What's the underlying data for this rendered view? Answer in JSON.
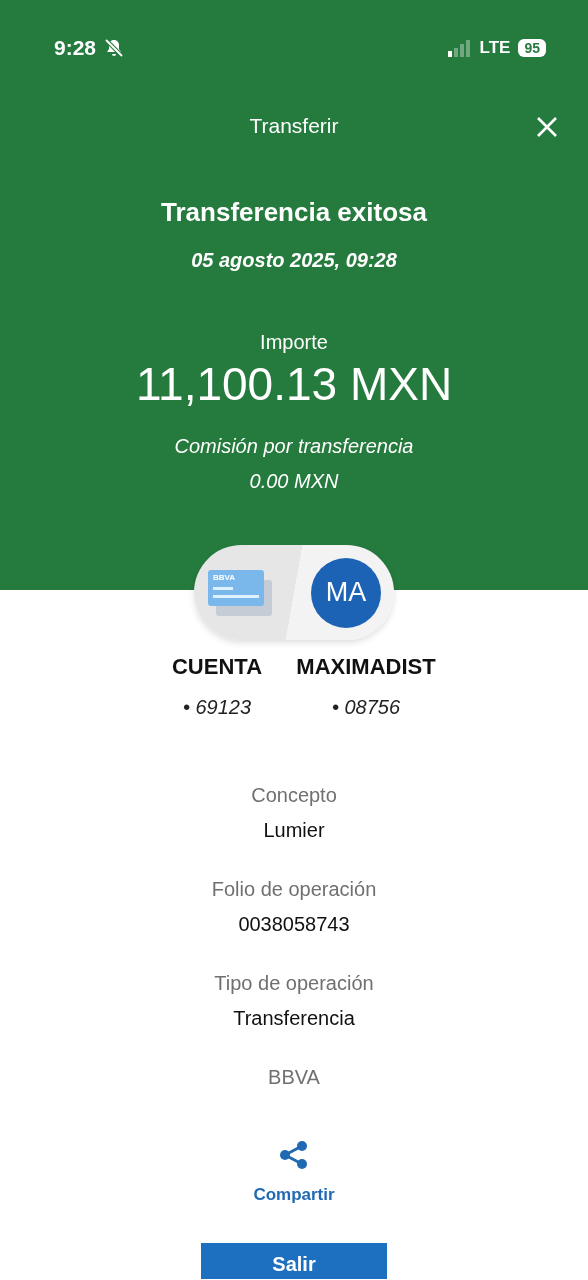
{
  "status_bar": {
    "time": "9:28",
    "network": "LTE",
    "battery": "95"
  },
  "header": {
    "title": "Transferir",
    "heading": "Transferencia exitosa",
    "date": "05 agosto 2025, 09:28",
    "amount_label": "Importe",
    "amount": "11,100.13 MXN",
    "fee_label": "Comisión por transferencia",
    "fee": "0.00 MXN"
  },
  "parties": [
    {
      "kind": "account",
      "name": "CUENTA",
      "number": "• 69123",
      "card_brand": "BBVA"
    },
    {
      "kind": "contact",
      "initials": "MA",
      "name": "MAXIMADIST",
      "number": "• 08756"
    }
  ],
  "details": [
    {
      "label": "Concepto",
      "value": "Lumier"
    },
    {
      "label": "Folio de operación",
      "value": "0038058743"
    },
    {
      "label": "Tipo de operación",
      "value": "Transferencia"
    },
    {
      "label": "BBVA"
    }
  ],
  "share": {
    "label": "Compartir"
  },
  "exit_button": {
    "label": "Salir"
  }
}
